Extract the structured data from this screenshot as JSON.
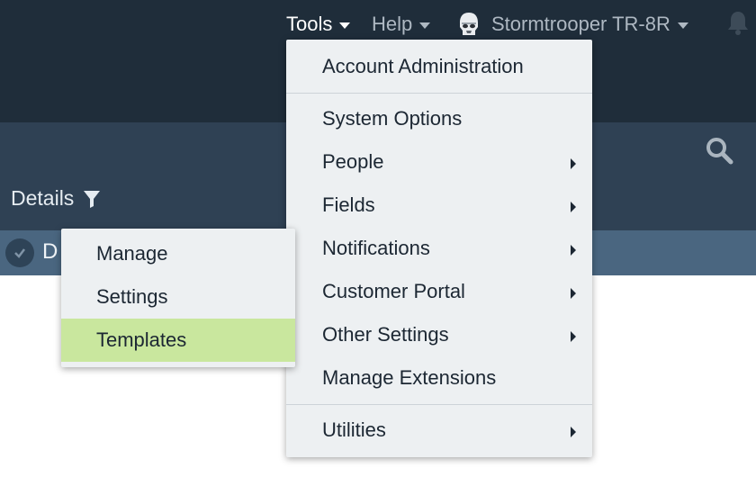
{
  "topnav": {
    "tools_label": "Tools",
    "help_label": "Help",
    "user_name": "Stormtrooper TR-8R"
  },
  "toolbar": {
    "details_label": "Details"
  },
  "row": {
    "first_letter": "D"
  },
  "tools_menu": {
    "items": [
      {
        "label": "Account Administration"
      },
      {
        "label": "System Options"
      },
      {
        "label": "People"
      },
      {
        "label": "Fields"
      },
      {
        "label": "Notifications"
      },
      {
        "label": "Customer Portal"
      },
      {
        "label": "Other Settings"
      },
      {
        "label": "Manage Extensions"
      },
      {
        "label": "Utilities"
      }
    ]
  },
  "submenu": {
    "items": [
      {
        "label": "Manage"
      },
      {
        "label": "Settings"
      },
      {
        "label": "Templates"
      }
    ],
    "selected": "Templates"
  },
  "colors": {
    "topbar": "#1f2d3a",
    "subbar": "#2f4154",
    "rowbar": "#4a6680",
    "menu_bg": "#edf0f2",
    "selected_bg": "#c9e79e"
  },
  "icons": [
    "avatar-stormtrooper",
    "bell-icon",
    "search-icon",
    "filter-icon",
    "check-icon",
    "chevron-right-icon",
    "caret-down-icon"
  ]
}
